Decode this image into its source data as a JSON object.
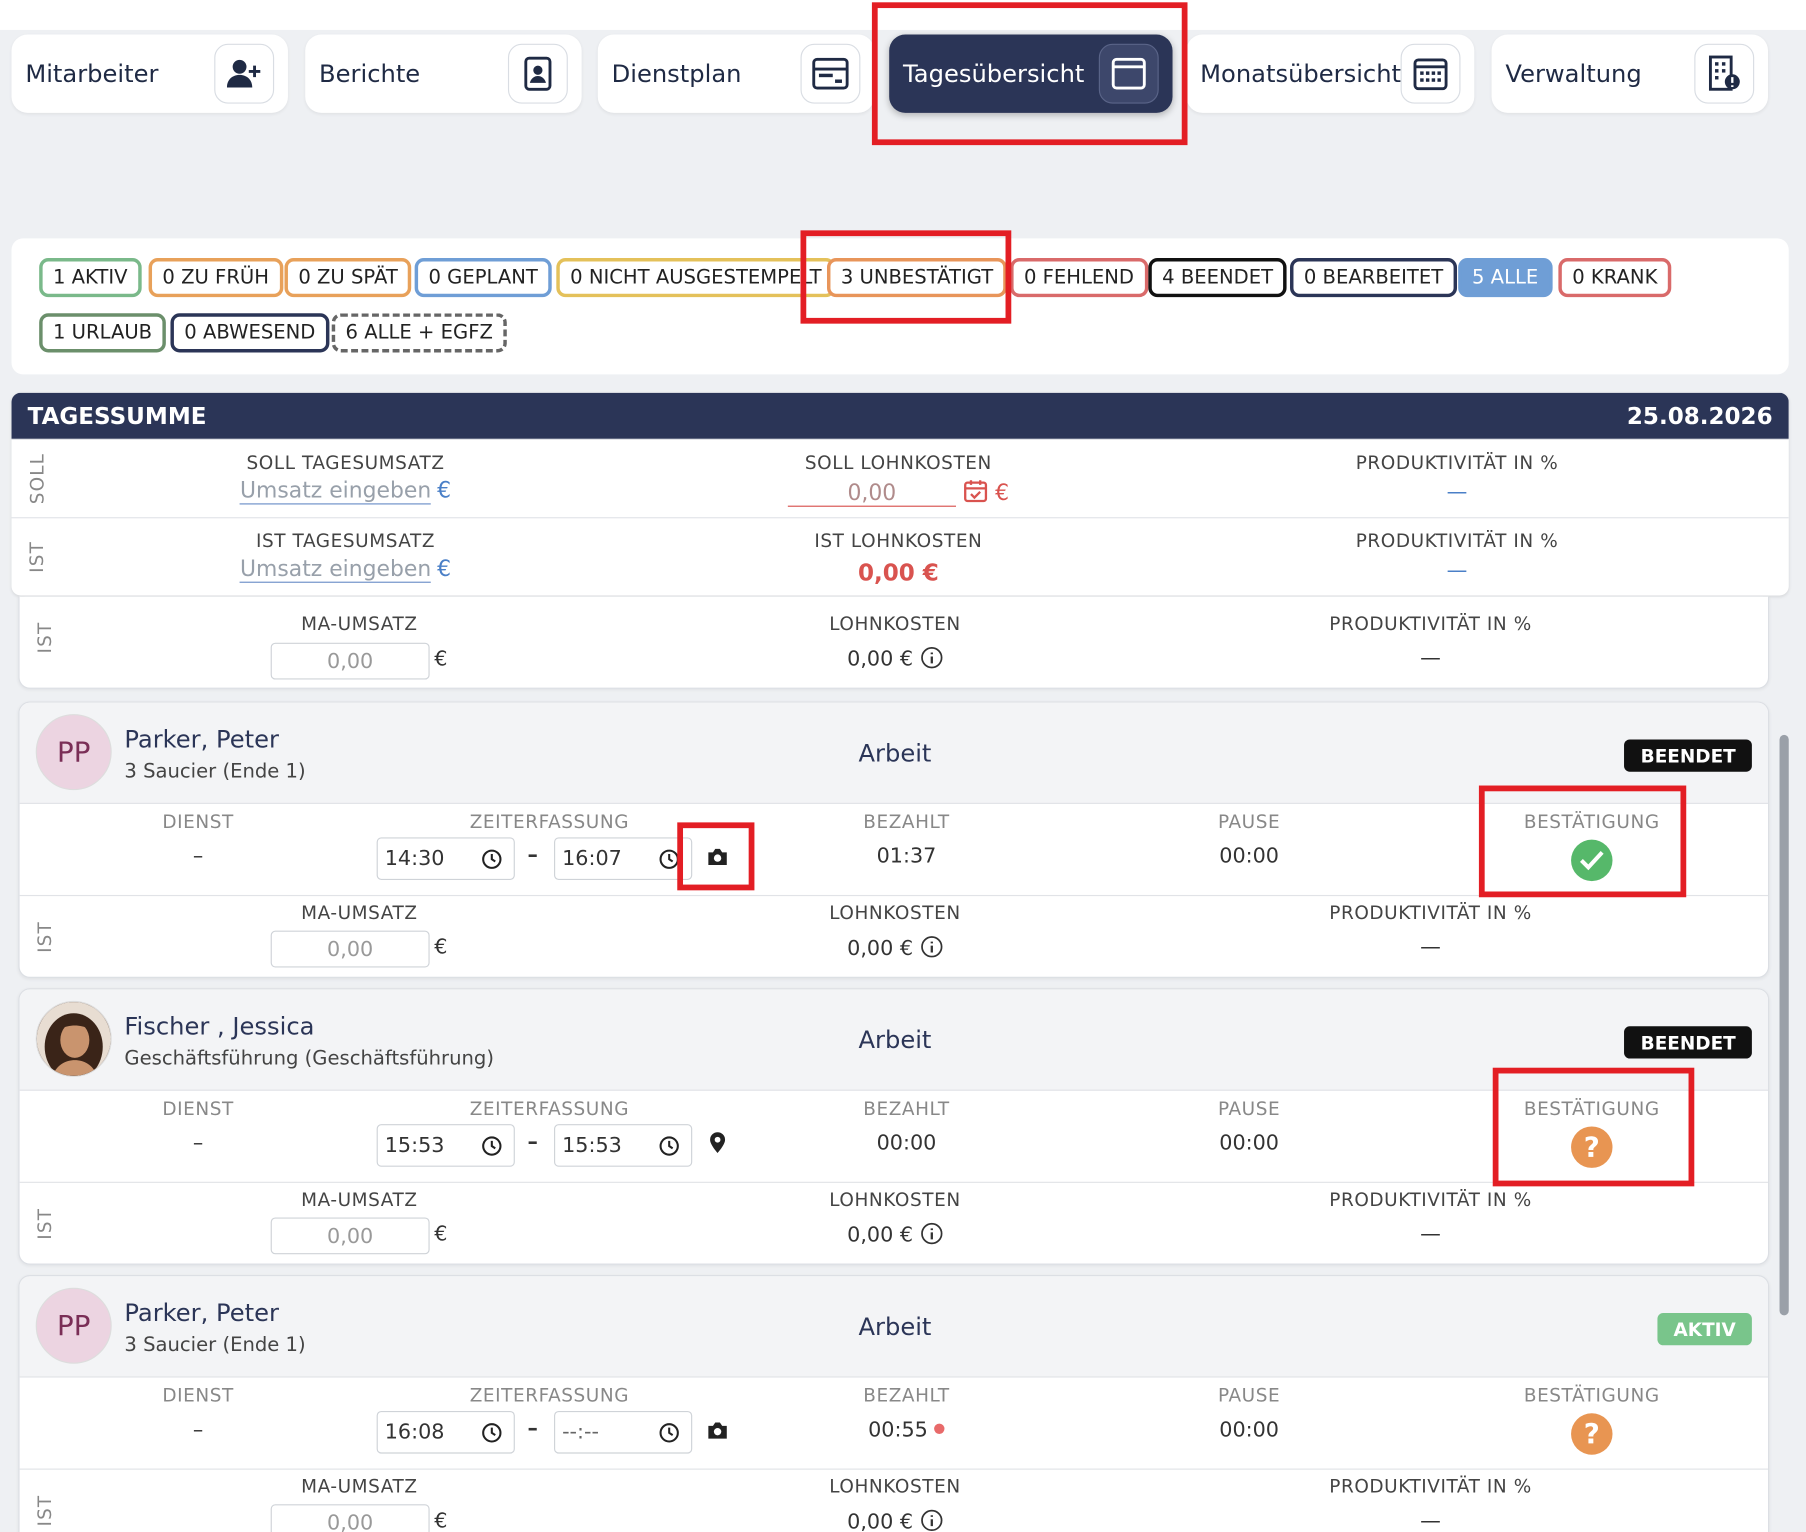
{
  "tabs": [
    {
      "label": "Mitarbeiter",
      "icon": "add-user-icon"
    },
    {
      "label": "Berichte",
      "icon": "report-icon"
    },
    {
      "label": "Dienstplan",
      "icon": "schedule-icon"
    },
    {
      "label": "Tagesübersicht",
      "icon": "window-icon",
      "active": true
    },
    {
      "label": "Monatsübersicht",
      "icon": "calendar-grid-icon"
    },
    {
      "label": "Verwaltung",
      "icon": "building-icon"
    }
  ],
  "filters": [
    {
      "label": "1 AKTIV",
      "color": "#7ab98a"
    },
    {
      "label": "0 ZU FRÜH",
      "color": "#e8a15a"
    },
    {
      "label": "0 ZU SPÄT",
      "color": "#e8a15a"
    },
    {
      "label": "0 GEPLANT",
      "color": "#6f9ed6"
    },
    {
      "label": "0 NICHT AUSGESTEMPELT",
      "color": "#e4c15a"
    },
    {
      "label": "3 UNBESTÄTIGT",
      "color": "#e8955a"
    },
    {
      "label": "0 FEHLEND",
      "color": "#d96a6a"
    },
    {
      "label": "4 BEENDET",
      "color": "#111111"
    },
    {
      "label": "0 BEARBEITET",
      "color": "#2b3557"
    },
    {
      "label": "5 ALLE",
      "color": "#6f9ed6"
    },
    {
      "label": "0 KRANK",
      "color": "#d96a6a"
    },
    {
      "label": "1 URLAUB",
      "color": "#6b8f6b"
    },
    {
      "label": "0 ABWESEND",
      "color": "#2b3557"
    },
    {
      "label": "6 ALLE + EGFZ",
      "color": "#666666"
    }
  ],
  "summary": {
    "title": "TAGESSUMME",
    "date": "25.08.2026",
    "soll_label": "SOLL",
    "ist_label": "IST",
    "soll_umsatz_label": "SOLL TAGESUMSATZ",
    "ist_umsatz_label": "IST TAGESUMSATZ",
    "umsatz_placeholder": "Umsatz eingeben",
    "currency": "€",
    "soll_lohn_label": "SOLL LOHNKOSTEN",
    "soll_lohn_value": "0,00",
    "ist_lohn_label": "IST LOHNKOSTEN",
    "ist_lohn_value": "0,00 €",
    "prod_label": "PRODUKTIVITÄT IN %",
    "prod_value": "—"
  },
  "labels": {
    "ist": "IST",
    "ma_umsatz": "MA-UMSATZ",
    "lohnkosten": "LOHNKOSTEN",
    "produktivitaet": "PRODUKTIVITÄT IN %",
    "dienst": "DIENST",
    "zeiterfassung": "ZEITERFASSUNG",
    "bezahlt": "BEZAHLT",
    "pause": "PAUSE",
    "bestaetigung": "BESTÄTIGUNG",
    "euro": "€",
    "dash": "–",
    "emdash": "—"
  },
  "top_ist": {
    "ma_umsatz": "0,00",
    "lohnkosten": "0,00 €",
    "prod": "—"
  },
  "employees": [
    {
      "initials": "PP",
      "name": "Parker, Peter",
      "role": "3 Saucier (Ende 1)",
      "type": "Arbeit",
      "status": "BEENDET",
      "dienst": "–",
      "start": "14:30",
      "end": "16:07",
      "capture_icon": "camera-icon",
      "bezahlt": "01:37",
      "pause": "00:00",
      "confirm": "confirmed",
      "ma_umsatz": "0,00",
      "lohnkosten": "0,00 €",
      "prod": "—"
    },
    {
      "initials": "",
      "name": "Fischer , Jessica",
      "role": "Geschäftsführung (Geschäftsführung)",
      "type": "Arbeit",
      "status": "BEENDET",
      "dienst": "–",
      "start": "15:53",
      "end": "15:53",
      "capture_icon": "location-pin-icon",
      "bezahlt": "00:00",
      "pause": "00:00",
      "confirm": "unconfirmed",
      "ma_umsatz": "0,00",
      "lohnkosten": "0,00 €",
      "prod": "—"
    },
    {
      "initials": "PP",
      "name": "Parker, Peter",
      "role": "3 Saucier (Ende 1)",
      "type": "Arbeit",
      "status": "AKTIV",
      "dienst": "–",
      "start": "16:08",
      "end": "--:--",
      "capture_icon": "camera-icon",
      "bezahlt": "00:55",
      "pause": "00:00",
      "confirm": "unconfirmed",
      "ma_umsatz": "0,00",
      "lohnkosten": "0,00 €",
      "prod": "—"
    }
  ],
  "colors": {
    "primary": "#2b3557",
    "confirmed": "#56b86a",
    "unconfirmed": "#e89552",
    "highlight": "#e31e24",
    "lohn_red": "#d9534f"
  }
}
